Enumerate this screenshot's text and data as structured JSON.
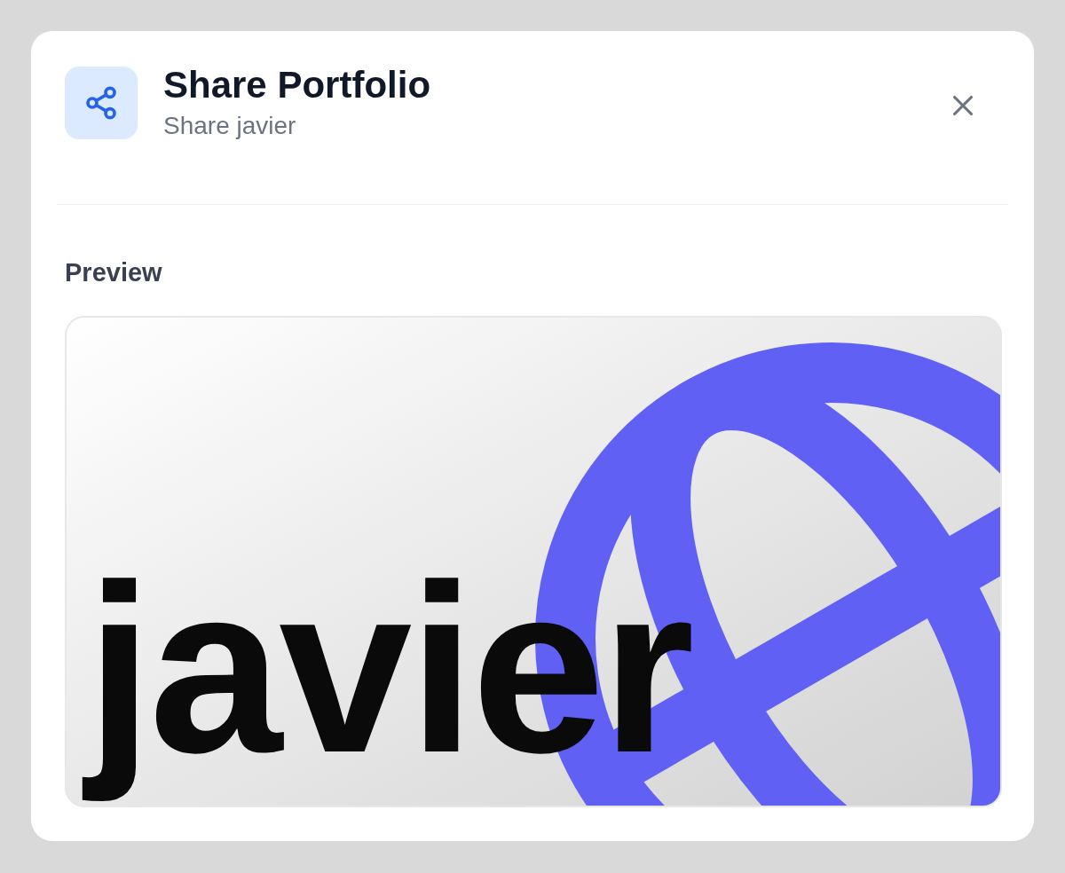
{
  "dialog": {
    "title": "Share Portfolio",
    "subtitle": "Share javier"
  },
  "preview": {
    "label": "Preview",
    "image_text": "javier"
  }
}
